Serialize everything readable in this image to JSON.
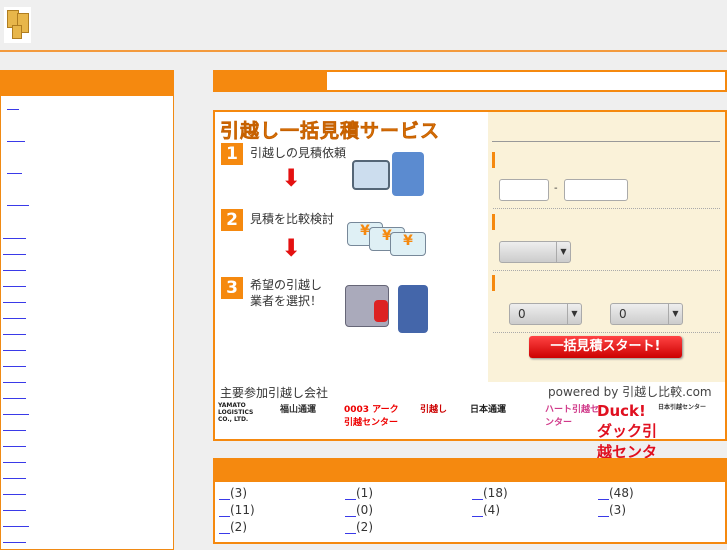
{
  "header": {
    "logo_icon": "cardboard-boxes-icon"
  },
  "service": {
    "title": "引越し一括見積サービス",
    "steps": [
      {
        "num": "1",
        "text": "引越しの見積依頼"
      },
      {
        "num": "2",
        "text": "見積を比較検討"
      },
      {
        "num": "3",
        "text": "希望の引越し業者を選択！"
      }
    ],
    "form": {
      "sep": "-",
      "floor_from": "0",
      "floor_to": "0",
      "submit": "一括見積スタート!"
    },
    "companies_label": "主要参加引越し会社",
    "powered": "powered by 引越し比較.com",
    "companies": [
      "YAMATO LOGISTICS CO., LTD.",
      "福山通運",
      "0003 アーク引越センター",
      "引越し",
      "日本通運",
      "ハート引越センター",
      "Duck! ダック引越センター",
      "日本引越センター"
    ]
  },
  "categories": [
    "(3)",
    "(1)",
    "(18)",
    "(48)",
    "(11)",
    "(0)",
    "(4)",
    "(3)",
    "(2)",
    "(2)"
  ],
  "colors": {
    "accent": "#f5890f",
    "panel": "#faf2d9",
    "link": "#3a3ae8"
  }
}
